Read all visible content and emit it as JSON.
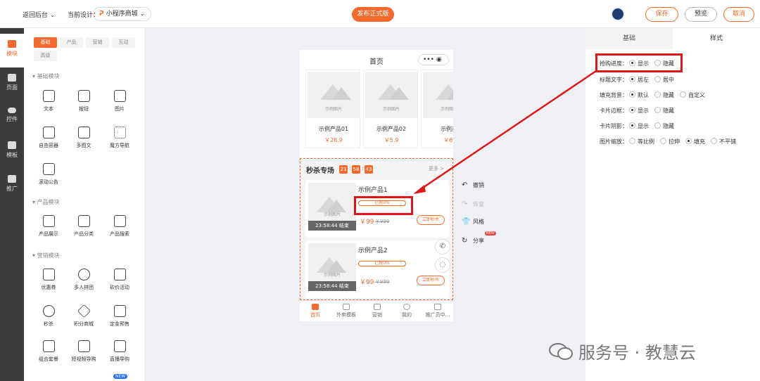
{
  "header": {
    "back_label": "返回后台",
    "current_design_label": "当前设计：",
    "design_name": "小程序商城",
    "publish_label": "发布正式版",
    "save_label": "保存",
    "preview_label": "预览",
    "cancel_label": "取消"
  },
  "nav": [
    {
      "label": "模块",
      "icon": "module-icon"
    },
    {
      "label": "页面",
      "icon": "page-icon"
    },
    {
      "label": "控件",
      "icon": "toggle-icon"
    },
    {
      "label": "模板",
      "icon": "template-icon"
    },
    {
      "label": "推广",
      "icon": "megaphone-icon"
    }
  ],
  "library": {
    "tabs": [
      "基础",
      "产品",
      "营销",
      "互动",
      "高级"
    ],
    "section_basic": "基础模块",
    "section_product": "产品模块",
    "section_marketing": "营销模块",
    "basic": [
      "文本",
      "按钮",
      "图片",
      "自由容器",
      "多图文",
      "魔方导航",
      "滚动公告"
    ],
    "product": [
      "产品展示",
      "产品分类",
      "产品搜索"
    ],
    "marketing": [
      "优惠券",
      "多人拼团",
      "砍价活动",
      "秒杀",
      "积分商城",
      "定金预售",
      "组合套餐",
      "短视频导购",
      "直播导购"
    ],
    "new_badge": "NEW"
  },
  "phone": {
    "title": "首页",
    "capsule": "•••",
    "products": [
      {
        "image_label": "示例图片",
        "name": "示例产品01",
        "price": "￥28.9"
      },
      {
        "image_label": "示例图片",
        "name": "示例产品02",
        "price": "￥5.9"
      },
      {
        "image_label": "示例图片",
        "name": "示例产",
        "price": "￥6."
      }
    ],
    "flash": {
      "title": "秒杀专场",
      "countdown": [
        "23",
        "58",
        "43"
      ],
      "more": "更多 >",
      "items": [
        {
          "image_label": "示例图片",
          "end": "23:58:44 结束",
          "name": "示例产品1",
          "progress": "已抢0%",
          "price": "￥99",
          "old_price": "￥999",
          "buy": "立即秒杀"
        },
        {
          "image_label": "示例图片",
          "end": "23:58:44 结束",
          "name": "示例产品2",
          "progress": "已抢0%",
          "price": "￥99",
          "old_price": "￥999",
          "buy": "立即秒杀"
        }
      ]
    },
    "tabbar": [
      "首页",
      "外卖模板",
      "营销",
      "我的",
      "推广员中..."
    ]
  },
  "side_actions": {
    "undo": "撤销",
    "redo": "恢复",
    "style": "风格",
    "share": "分享",
    "new_tag": "NEW"
  },
  "right_panel": {
    "tabs": [
      "基础",
      "样式"
    ],
    "props": [
      {
        "label": "抢购进度：",
        "options": [
          "显示",
          "隐藏"
        ],
        "selected": 0
      },
      {
        "label": "标题文字：",
        "options": [
          "居左",
          "居中"
        ],
        "selected": 0
      },
      {
        "label": "填充背景：",
        "options": [
          "默认",
          "隐藏",
          "自定义"
        ],
        "selected": 0
      },
      {
        "label": "卡片边框：",
        "options": [
          "显示",
          "隐藏"
        ],
        "selected": 0
      },
      {
        "label": "卡片阴影：",
        "options": [
          "显示",
          "隐藏"
        ],
        "selected": 0
      },
      {
        "label": "图片缩放：",
        "options": [
          "等比例",
          "拉伸",
          "填充",
          "不平铺"
        ],
        "selected": 2
      }
    ]
  },
  "watermark": "服务号 · 教慧云",
  "colors": {
    "accent": "#f56a2c",
    "highlight": "#e0161d",
    "sidebar": "#3c3c3c"
  }
}
